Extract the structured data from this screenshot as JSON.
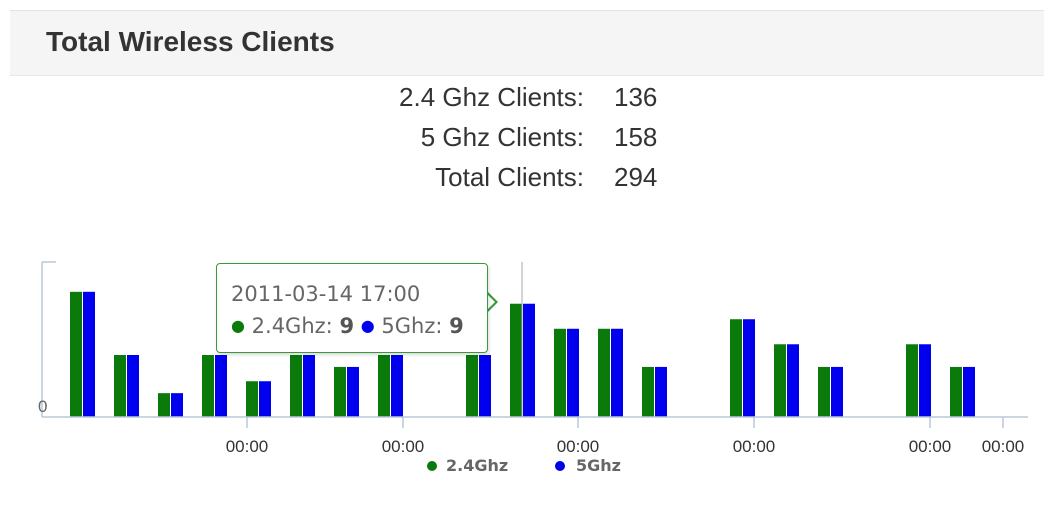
{
  "panel": {
    "title": "Total Wireless Clients"
  },
  "stats": [
    {
      "label": "2.4 Ghz Clients:",
      "value": "136"
    },
    {
      "label": "5 Ghz Clients:",
      "value": "158"
    },
    {
      "label": "Total Clients:",
      "value": "294"
    }
  ],
  "tooltip": {
    "date": "2011-03-14 17:00",
    "series": [
      {
        "name": "2.4Ghz",
        "value": "9",
        "color": "#0a7a0a"
      },
      {
        "name": "5Ghz",
        "value": "9",
        "color": "#0000ee"
      }
    ]
  },
  "colors": {
    "ghz24": "#0a7a0a",
    "ghz5": "#0000ee",
    "axis": "#b8c8d8"
  },
  "chart_data": {
    "type": "bar",
    "y_tick_labels": [
      "0"
    ],
    "x_tick_labels": [
      "00:00",
      "00:00",
      "00:00",
      "00:00",
      "00:00",
      "00:00"
    ],
    "series": [
      {
        "name": "2.4Ghz",
        "values": [
          10.5,
          5.2,
          2.0,
          5.2,
          3.0,
          5.2,
          4.2,
          5.2,
          null,
          5.2,
          9.5,
          7.4,
          7.4,
          4.2,
          null,
          8.2,
          6.1,
          4.2,
          null,
          6.1,
          4.2
        ]
      },
      {
        "name": "5Ghz",
        "values": [
          10.5,
          5.2,
          2.0,
          5.2,
          3.0,
          5.2,
          4.2,
          5.2,
          null,
          5.2,
          9.5,
          7.4,
          7.4,
          4.2,
          null,
          8.2,
          6.1,
          4.2,
          null,
          6.1,
          4.2
        ]
      }
    ],
    "ylim": [
      0,
      13
    ],
    "legend_position": "bottom"
  }
}
